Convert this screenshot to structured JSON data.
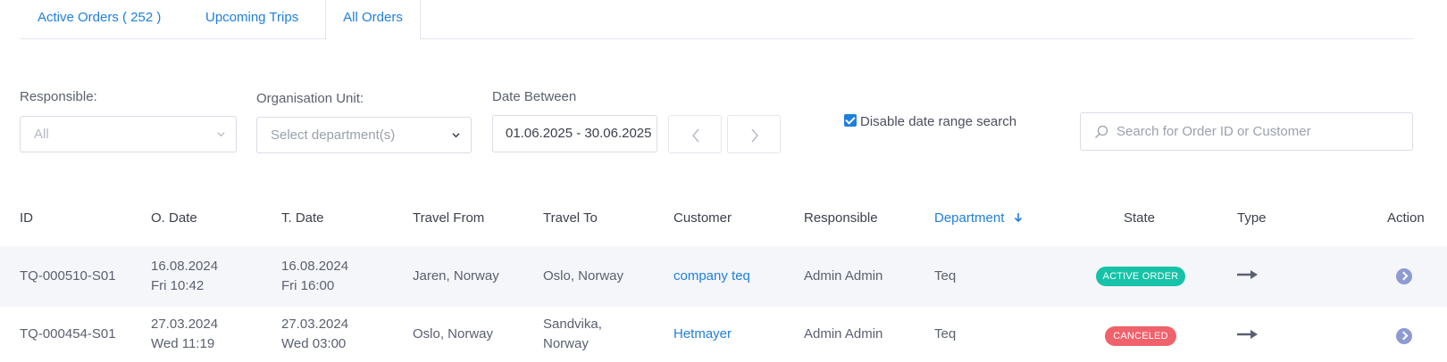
{
  "tabs": [
    {
      "label": "Active Orders ( 252 )"
    },
    {
      "label": "Upcoming Trips"
    },
    {
      "label": "All Orders"
    }
  ],
  "filters": {
    "responsible_label": "Responsible:",
    "responsible_value": "All",
    "org_label": "Organisation Unit:",
    "org_placeholder": "Select department(s)",
    "date_label": "Date Between",
    "date_value": "01.06.2025 - 30.06.2025",
    "disable_date_label": "Disable date range search",
    "disable_date_checked": true,
    "search_placeholder": "Search for Order ID or Customer"
  },
  "table": {
    "headers": {
      "id": "ID",
      "o_date": "O. Date",
      "t_date": "T. Date",
      "travel_from": "Travel From",
      "travel_to": "Travel To",
      "customer": "Customer",
      "responsible": "Responsible",
      "department": "Department",
      "state": "State",
      "type": "Type",
      "action": "Action"
    },
    "rows": [
      {
        "id": "TQ-000510-S01",
        "o_date": "16.08.2024",
        "o_time": "Fri 10:42",
        "t_date": "16.08.2024",
        "t_time": "Fri 16:00",
        "travel_from": "Jaren, Norway",
        "travel_to_1": "Oslo, Norway",
        "travel_to_2": "",
        "customer": "company teq",
        "responsible": "Admin Admin",
        "department": "Teq",
        "state": "ACTIVE ORDER"
      },
      {
        "id": "TQ-000454-S01",
        "o_date": "27.03.2024",
        "o_time": "Wed 11:19",
        "t_date": "27.03.2024",
        "t_time": "Wed 03:00",
        "travel_from": "Oslo, Norway",
        "travel_to_1": "Sandvika,",
        "travel_to_2": "Norway",
        "customer": "Hetmayer",
        "responsible": "Admin Admin",
        "department": "Teq",
        "state": "CANCELED"
      }
    ]
  },
  "colors": {
    "accent": "#1f7fe0",
    "active_badge": "#16c2a8",
    "canceled_badge": "#f0616b",
    "action_icon": "#8e9bd3"
  },
  "icons": {
    "select_chevron": "chevron-down-icon",
    "prev": "chevron-left-icon",
    "next": "chevron-right-icon",
    "search": "search-icon",
    "sort": "arrow-down-icon",
    "type": "arrow-right-icon",
    "action": "circle-chevron-right-icon"
  }
}
